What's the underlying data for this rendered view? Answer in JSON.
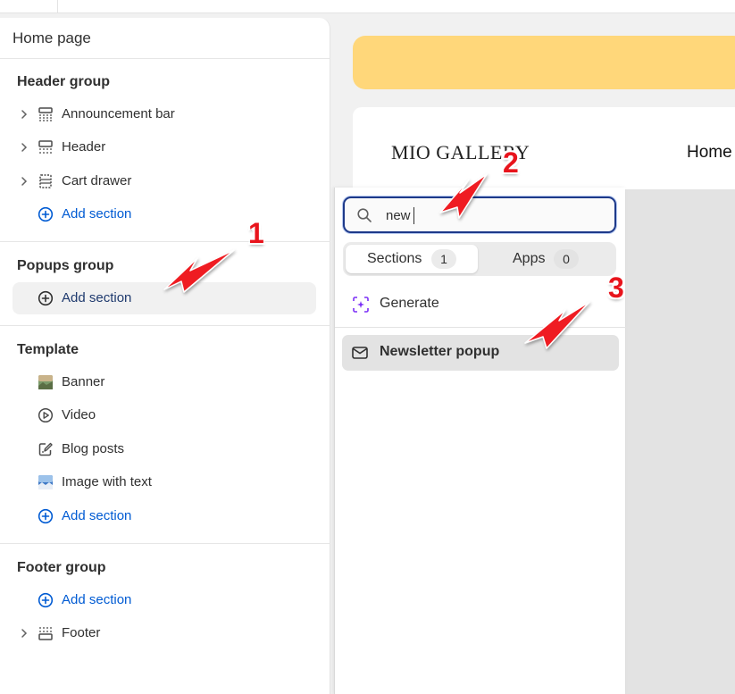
{
  "sidebar": {
    "title": "Home page",
    "groups": [
      {
        "title": "Header group",
        "items": [
          {
            "label": "Announcement bar",
            "icon": "announcement-bar-icon",
            "expandable": true
          },
          {
            "label": "Header",
            "icon": "header-icon",
            "expandable": true
          },
          {
            "label": "Cart drawer",
            "icon": "cart-drawer-icon",
            "expandable": true
          },
          {
            "label": "Add section",
            "icon": "plus-circle-icon",
            "action": true
          }
        ]
      },
      {
        "title": "Popups group",
        "items": [
          {
            "label": "Add section",
            "icon": "plus-circle-icon",
            "action": true,
            "hovered": true
          }
        ]
      },
      {
        "title": "Template",
        "items": [
          {
            "label": "Banner",
            "icon": "image-thumbnail-icon"
          },
          {
            "label": "Video",
            "icon": "play-icon"
          },
          {
            "label": "Blog posts",
            "icon": "edit-icon"
          },
          {
            "label": "Image with text",
            "icon": "image-thumbnail-icon"
          },
          {
            "label": "Add section",
            "icon": "plus-circle-icon",
            "action": true
          }
        ]
      },
      {
        "title": "Footer group",
        "items": [
          {
            "label": "Add section",
            "icon": "plus-circle-icon",
            "action": true
          },
          {
            "label": "Footer",
            "icon": "footer-icon",
            "expandable": true
          }
        ]
      }
    ]
  },
  "preview": {
    "logo": "MIO GALLERY",
    "nav_home": "Home"
  },
  "popup": {
    "search": {
      "value": "new",
      "icon": "search-icon"
    },
    "tabs": [
      {
        "label": "Sections",
        "count": "1",
        "active": true
      },
      {
        "label": "Apps",
        "count": "0",
        "active": false
      }
    ],
    "generate": {
      "label": "Generate",
      "icon": "sparkle-frame-icon"
    },
    "results": [
      {
        "label": "Newsletter popup",
        "icon": "mail-icon"
      }
    ]
  },
  "annotations": {
    "step1": "1",
    "step2": "2",
    "step3": "3",
    "color": "#e8141c"
  },
  "colors": {
    "accent_blue": "#005bd3",
    "yellow_banner": "#ffd77a",
    "search_border": "#1e3a8a"
  }
}
